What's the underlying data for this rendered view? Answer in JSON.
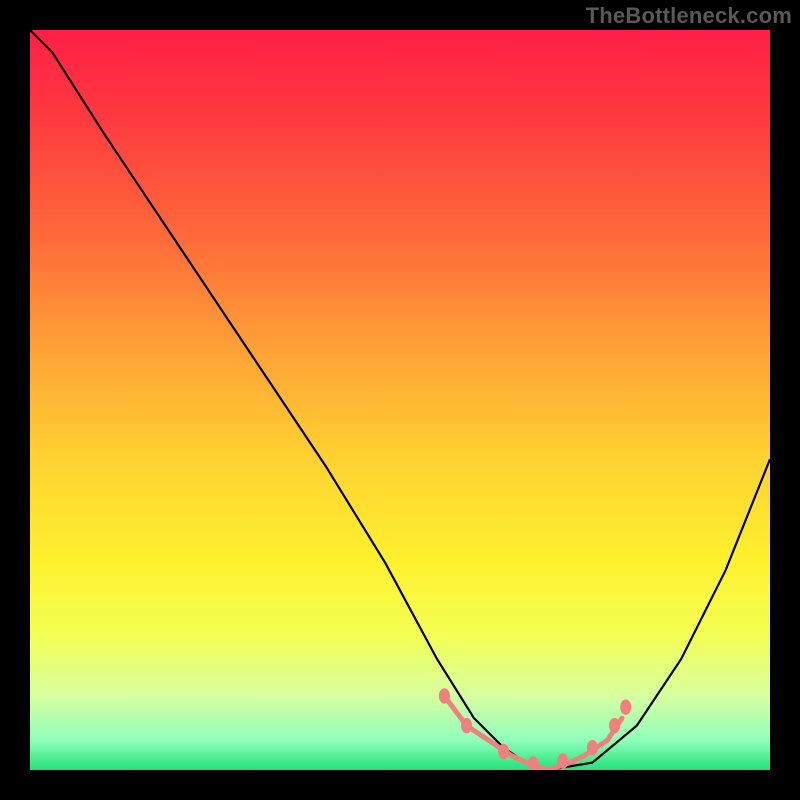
{
  "watermark": "TheBottleneck.com",
  "chart_data": {
    "type": "line",
    "title": "",
    "xlabel": "",
    "ylabel": "",
    "xlim": [
      0,
      100
    ],
    "ylim": [
      0,
      100
    ],
    "legend": null,
    "gradient_colors_top_to_bottom": [
      "#ff1f46",
      "#ffd231",
      "#fff12e",
      "#23e27a"
    ],
    "series": [
      {
        "name": "curve",
        "stroke": "#000000",
        "x": [
          0,
          3,
          10,
          20,
          30,
          40,
          48,
          55,
          60,
          64,
          67,
          70,
          76,
          82,
          88,
          94,
          100
        ],
        "values": [
          100,
          97,
          86,
          71,
          56,
          41,
          28,
          15,
          7,
          3,
          1,
          0,
          1,
          6,
          15,
          27,
          42
        ]
      },
      {
        "name": "highlight-segment",
        "stroke": "#f08080",
        "x": [
          56,
          59,
          62,
          65,
          67,
          70,
          73,
          75,
          78,
          80
        ],
        "values": [
          10,
          6,
          4,
          2,
          1,
          0,
          1,
          2,
          4,
          7
        ]
      }
    ],
    "highlight_dots": {
      "stroke": "#f08080",
      "points": [
        {
          "x": 56,
          "y": 10
        },
        {
          "x": 59,
          "y": 6
        },
        {
          "x": 64,
          "y": 2.5
        },
        {
          "x": 68,
          "y": 0.8
        },
        {
          "x": 72,
          "y": 1.2
        },
        {
          "x": 76,
          "y": 3
        },
        {
          "x": 79,
          "y": 6
        },
        {
          "x": 80.5,
          "y": 8.5
        }
      ]
    }
  }
}
